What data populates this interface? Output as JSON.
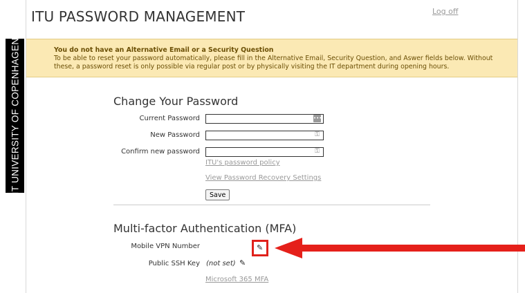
{
  "header": {
    "title": "ITU PASSWORD MANAGEMENT",
    "logoff_label": "Log off"
  },
  "side_banner": {
    "text": "IT UNIVERSITY OF COPENHAGEN"
  },
  "alert": {
    "title": "You do not have an Alternative Email or a Security Question",
    "body": "To be able to reset your password automatically, please fill in the Alternative Email, Security Question, and Aswer fields below. Without these, a password reset is only possible via regular post or by physically visiting the IT department during opening hours."
  },
  "change_password": {
    "heading": "Change Your Password",
    "current_label": "Current Password",
    "new_label": "New Password",
    "confirm_label": "Confirm new password",
    "policy_link": "ITU's password policy",
    "recovery_link": "View Password Recovery Settings",
    "save_label": "Save"
  },
  "mfa": {
    "heading": "Multi-factor Authentication (MFA)",
    "vpn_label": "Mobile VPN Number",
    "ssh_label": "Public SSH Key",
    "ssh_value": "(not set)",
    "m365_link": "Microsoft 365 MFA"
  },
  "colors": {
    "alert_bg": "#fbe9b4",
    "highlight": "#e5201a",
    "banner": "#000000"
  },
  "icons": [
    "password-manager-icon",
    "key-icon",
    "key-icon",
    "pencil-icon",
    "pencil-icon",
    "arrow-left-icon"
  ]
}
